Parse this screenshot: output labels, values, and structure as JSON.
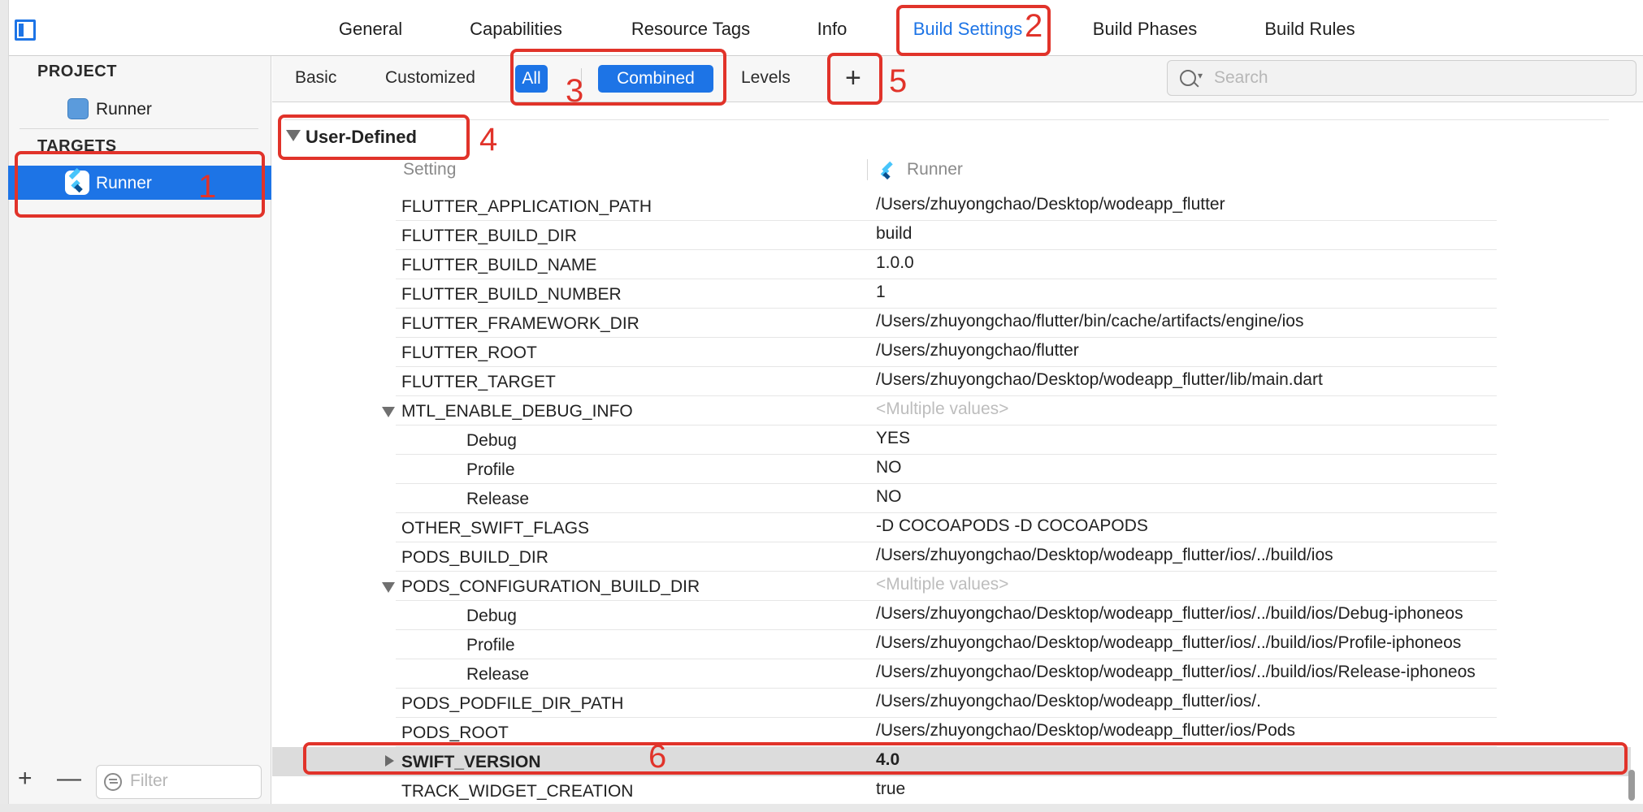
{
  "top_tabs": [
    "General",
    "Capabilities",
    "Resource Tags",
    "Info",
    "Build Settings",
    "Build Phases",
    "Build Rules"
  ],
  "sidebar": {
    "project_heading": "PROJECT",
    "project_item": "Runner",
    "targets_heading": "TARGETS",
    "target_item": "Runner",
    "filter_placeholder": "Filter",
    "add_label": "+",
    "remove_label": "—"
  },
  "subbar": {
    "basic": "Basic",
    "customized": "Customized",
    "all": "All",
    "combined": "Combined",
    "levels": "Levels",
    "plus": "+",
    "search_placeholder": "Search"
  },
  "section": {
    "title": "User-Defined",
    "col_setting": "Setting",
    "col_target": "Runner"
  },
  "rows": [
    {
      "key": "FLUTTER_APPLICATION_PATH",
      "value": "/Users/zhuyongchao/Desktop/wodeapp_flutter"
    },
    {
      "key": "FLUTTER_BUILD_DIR",
      "value": "build"
    },
    {
      "key": "FLUTTER_BUILD_NAME",
      "value": "1.0.0"
    },
    {
      "key": "FLUTTER_BUILD_NUMBER",
      "value": "1"
    },
    {
      "key": "FLUTTER_FRAMEWORK_DIR",
      "value": "/Users/zhuyongchao/flutter/bin/cache/artifacts/engine/ios"
    },
    {
      "key": "FLUTTER_ROOT",
      "value": "/Users/zhuyongchao/flutter"
    },
    {
      "key": "FLUTTER_TARGET",
      "value": "/Users/zhuyongchao/Desktop/wodeapp_flutter/lib/main.dart"
    },
    {
      "key": "MTL_ENABLE_DEBUG_INFO",
      "value": "<Multiple values>"
    },
    {
      "key": "Debug",
      "value": "YES"
    },
    {
      "key": "Profile",
      "value": "NO"
    },
    {
      "key": "Release",
      "value": "NO"
    },
    {
      "key": "OTHER_SWIFT_FLAGS",
      "value": " -D COCOAPODS -D COCOAPODS"
    },
    {
      "key": "PODS_BUILD_DIR",
      "value": "/Users/zhuyongchao/Desktop/wodeapp_flutter/ios/../build/ios"
    },
    {
      "key": "PODS_CONFIGURATION_BUILD_DIR",
      "value": "<Multiple values>"
    },
    {
      "key": "Debug",
      "value": "/Users/zhuyongchao/Desktop/wodeapp_flutter/ios/../build/ios/Debug-iphoneos"
    },
    {
      "key": "Profile",
      "value": "/Users/zhuyongchao/Desktop/wodeapp_flutter/ios/../build/ios/Profile-iphoneos"
    },
    {
      "key": "Release",
      "value": "/Users/zhuyongchao/Desktop/wodeapp_flutter/ios/../build/ios/Release-iphoneos"
    },
    {
      "key": "PODS_PODFILE_DIR_PATH",
      "value": "/Users/zhuyongchao/Desktop/wodeapp_flutter/ios/."
    },
    {
      "key": "PODS_ROOT",
      "value": "/Users/zhuyongchao/Desktop/wodeapp_flutter/ios/Pods"
    },
    {
      "key": "SWIFT_VERSION",
      "value": "4.0"
    },
    {
      "key": "TRACK_WIDGET_CREATION",
      "value": "true"
    }
  ],
  "annotations": [
    "1",
    "2",
    "3",
    "4",
    "5",
    "6"
  ],
  "colors": {
    "accent": "#1d74e6",
    "annotation": "#e1332a",
    "highlight_row": "#dcdcdc"
  }
}
